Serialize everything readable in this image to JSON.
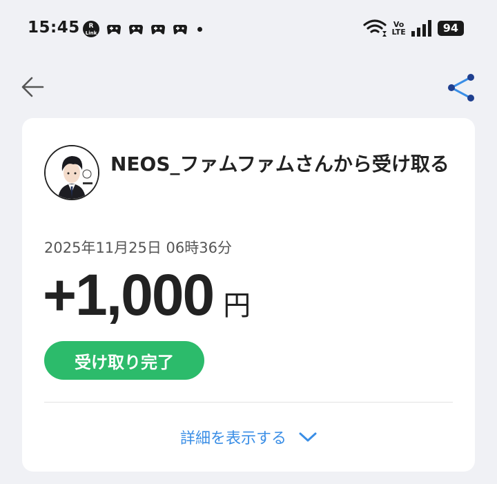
{
  "status_bar": {
    "time": "15:45",
    "rlink_line1": "R",
    "rlink_line2": "Link",
    "volte_line1": "Vo",
    "volte_line2": "LTE",
    "battery": "94"
  },
  "transaction": {
    "title": "NEOS_ファムファムさんから受け取る",
    "datetime": "2025年11月25日 06時36分",
    "amount": "+1,000",
    "currency": "円",
    "status": "受け取り完了",
    "details_link": "詳細を表示する"
  },
  "colors": {
    "background": "#f0f1f5",
    "accent_blue": "#3a8ee6",
    "success_green": "#2cbb6b"
  },
  "icons": {
    "back": "arrow-left-icon",
    "share": "share-icon",
    "chevron": "chevron-down-icon"
  }
}
